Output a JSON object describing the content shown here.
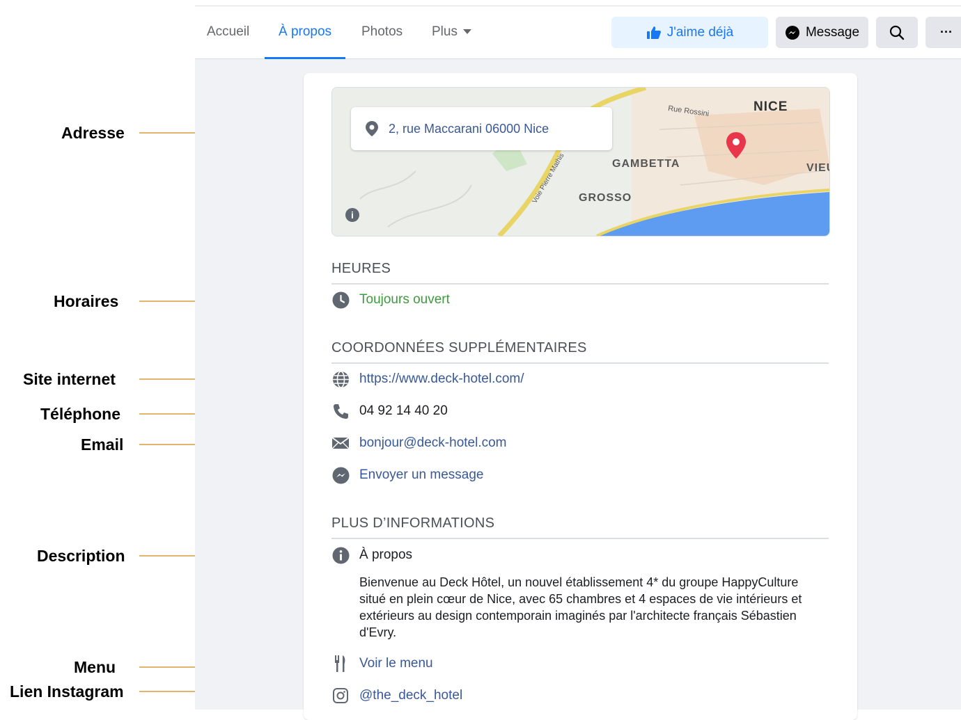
{
  "annotations": [
    {
      "label": "Adresse"
    },
    {
      "label": "Horaires"
    },
    {
      "label": "Site internet"
    },
    {
      "label": "Téléphone"
    },
    {
      "label": "Email"
    },
    {
      "label": "Description"
    },
    {
      "label": "Menu"
    },
    {
      "label": "Lien Instagram"
    }
  ],
  "nav": {
    "tabs": [
      {
        "label": "Accueil"
      },
      {
        "label": "À propos",
        "active": true
      },
      {
        "label": "Photos"
      },
      {
        "label": "Plus"
      }
    ],
    "like_button": "J'aime déjà",
    "message_button": "Message",
    "more_button": "···"
  },
  "map": {
    "address": "2, rue Maccarani 06000 Nice",
    "labels": [
      "NICE",
      "GAMBETTA",
      "GROSSO",
      "VIEU",
      "Rue Rossini",
      "Voie Pierre Mathis"
    ]
  },
  "hours": {
    "title": "HEURES",
    "status": "Toujours ouvert"
  },
  "contact": {
    "title": "COORDONNÉES SUPPLÉMENTAIRES",
    "website": "https://www.deck-hotel.com/",
    "phone": "04 92 14 40 20",
    "email": "bonjour@deck-hotel.com",
    "messenger": "Envoyer un message"
  },
  "more_info": {
    "title": "PLUS D’INFORMATIONS",
    "about_heading": "À propos",
    "description": "Bienvenue au Deck Hôtel, un nouvel établissement 4* du groupe HappyCulture situé en plein cœur de Nice, avec 65 chambres et 4 espaces de vie intérieurs et extérieurs au design contemporain imaginés par l'architecte français Sébastien d'Evry.",
    "menu": "Voir le menu",
    "instagram": "@the_deck_hotel"
  },
  "colors": {
    "accent": "#1877f2",
    "link": "#385898",
    "open_green": "#3e9a3e",
    "arrow": "#e3b46b"
  }
}
